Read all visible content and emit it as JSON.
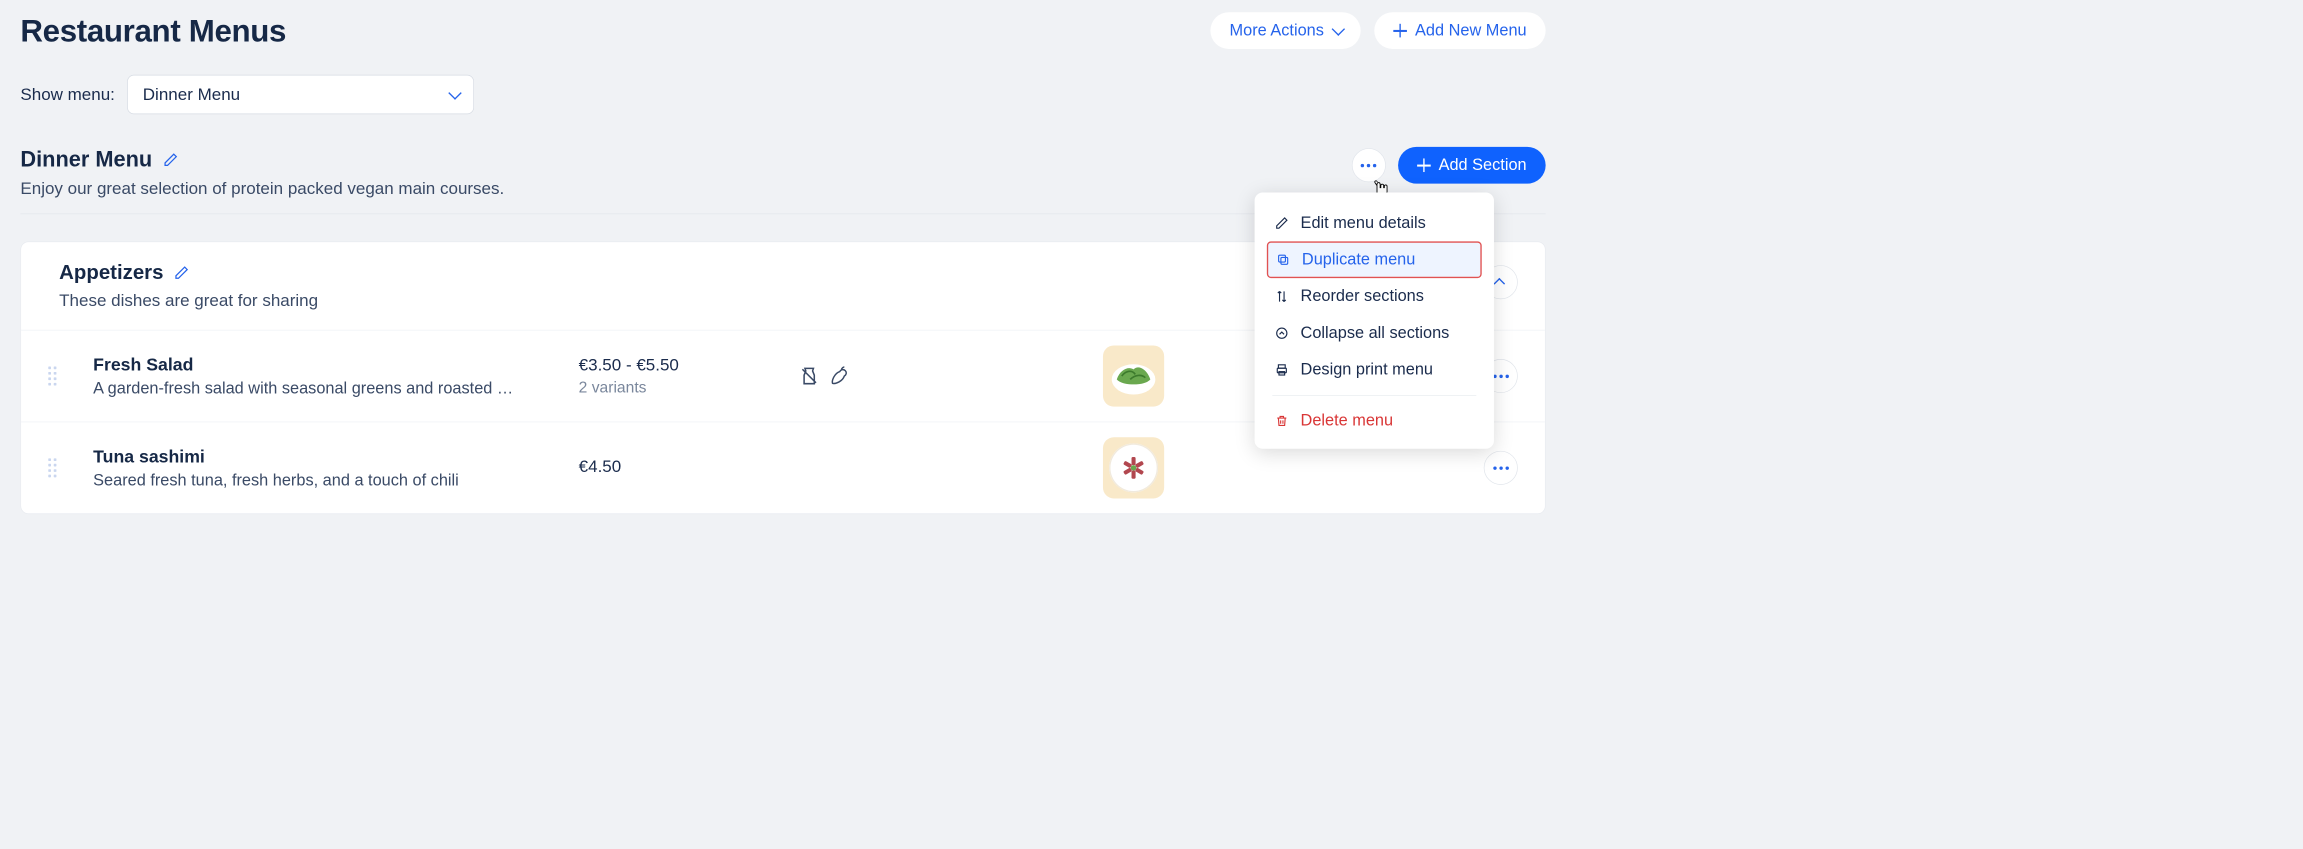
{
  "header": {
    "title": "Restaurant Menus",
    "more_actions": "More Actions",
    "add_new": "Add New Menu"
  },
  "filter": {
    "label": "Show menu:",
    "selected": "Dinner Menu"
  },
  "menu": {
    "title": "Dinner Menu",
    "description": "Enjoy our great selection of protein packed vegan main courses.",
    "add_section": "Add Section"
  },
  "popup": {
    "edit": "Edit menu details",
    "duplicate": "Duplicate menu",
    "reorder": "Reorder sections",
    "collapse": "Collapse all sections",
    "design": "Design print menu",
    "delete": "Delete menu"
  },
  "section": {
    "title": "Appetizers",
    "description": "These dishes are great for sharing"
  },
  "items": [
    {
      "name": "Fresh Salad",
      "description": "A garden-fresh salad with seasonal greens and roasted …",
      "price": "€3.50 - €5.50",
      "variants": "2 variants"
    },
    {
      "name": "Tuna sashimi",
      "description": "Seared fresh tuna, fresh herbs, and a touch of chili",
      "price": "€4.50",
      "variants": ""
    }
  ]
}
